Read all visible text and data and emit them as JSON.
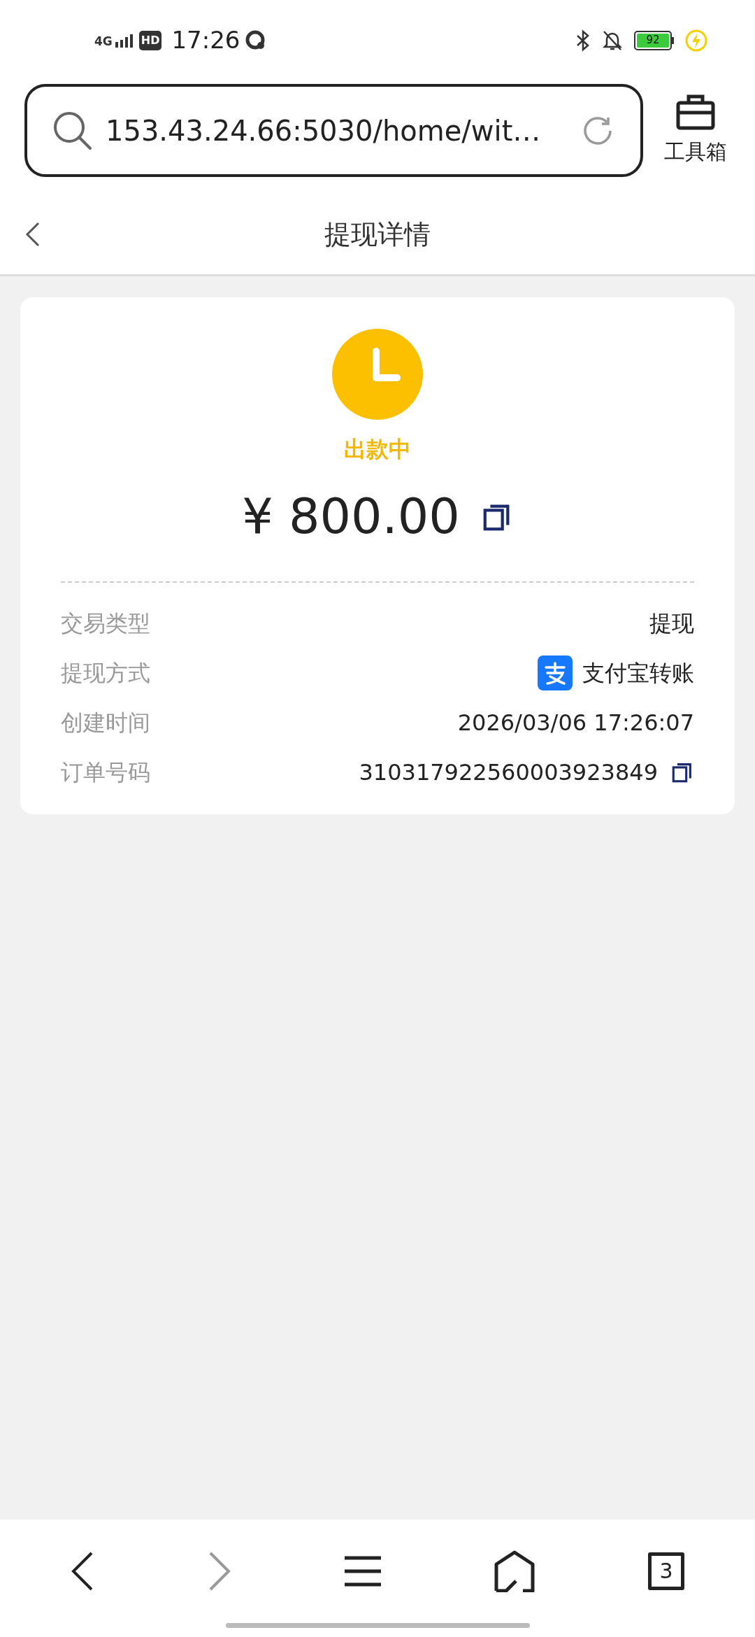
{
  "status_bar": {
    "network": "4G",
    "hd": "HD",
    "time": "17:26",
    "battery": "92"
  },
  "address_bar": {
    "url": "153.43.24.66:5030/home/wit…"
  },
  "toolbox": {
    "label": "工具箱"
  },
  "header": {
    "title": "提现详情"
  },
  "status": {
    "label": "出款中"
  },
  "amount": "¥ 800.00",
  "details": [
    {
      "kind": "text",
      "label": "交易类型",
      "value": "提现"
    },
    {
      "kind": "payment",
      "label": "提现方式",
      "value": "支付宝转账"
    },
    {
      "kind": "text",
      "label": "创建时间",
      "value": "2026/03/06 17:26:07"
    },
    {
      "kind": "copy",
      "label": "订单号码",
      "value": "310317922560003923849"
    }
  ],
  "bottom_nav": {
    "forward_disabled": true,
    "tab_count": "3"
  }
}
